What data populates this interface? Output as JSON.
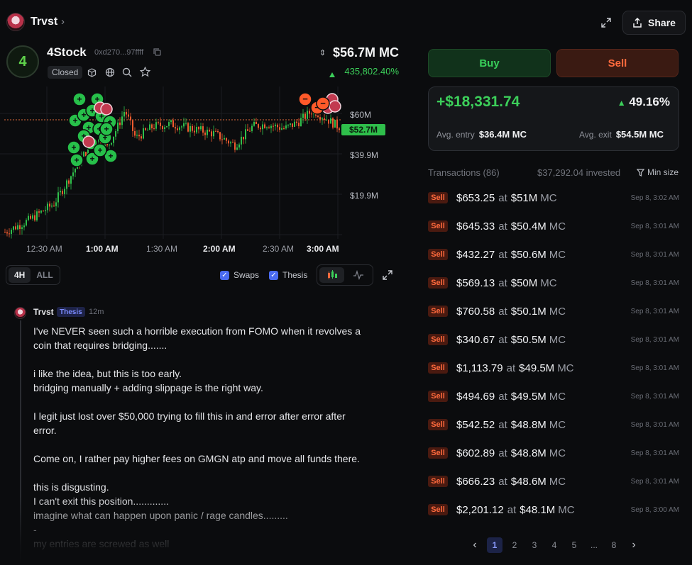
{
  "header": {
    "user_name": "Trvst",
    "share_label": "Share"
  },
  "token": {
    "name": "4Stock",
    "address": "0xd270...97ffff",
    "status": "Closed",
    "market_cap": "$56.7M MC",
    "change": "435,802.40%",
    "logo_text": "4"
  },
  "chart": {
    "time_labels": [
      "12:30 AM",
      "1:00 AM",
      "1:30 AM",
      "2:00 AM",
      "2:30 AM",
      "3:00 AM"
    ],
    "y_labels": [
      "$60M",
      "$39.9M",
      "$19.9M"
    ],
    "current_price": "$52.7M"
  },
  "chart_data": {
    "type": "line",
    "title": "",
    "xlabel": "",
    "ylabel": "",
    "x": [
      "12:30 AM",
      "1:00 AM",
      "1:30 AM",
      "2:00 AM",
      "2:30 AM",
      "3:00 AM"
    ],
    "y_ticks": [
      "$19.9M",
      "$39.9M",
      "$60M"
    ],
    "current_value": 52.7,
    "ylim": [
      5,
      70
    ]
  },
  "controls": {
    "range_4h": "4H",
    "range_all": "ALL",
    "swaps_label": "Swaps",
    "thesis_label": "Thesis"
  },
  "comment": {
    "author": "Trvst",
    "badge": "Thesis",
    "time": "12m",
    "paragraphs": [
      "I've NEVER seen such a horrible execution from FOMO when it revolves a coin that requires bridging.......",
      "i like the idea, but this is too early.\nbridging manually + adding slippage is the right way.",
      "I legit just lost over $50,000 trying to fill this in and error after error after error.",
      "Come on, I rather pay higher fees on GMGN atp and move all funds there.",
      "this is disgusting.\nI can't exit this position.............\nimagine what can happen upon panic / rage candles.........\n-\nmy entries are screwed as well"
    ]
  },
  "trade": {
    "buy_label": "Buy",
    "sell_label": "Sell",
    "pnl": "+$18,331.74",
    "pnl_pct": "49.16%",
    "avg_entry_label": "Avg. entry",
    "avg_entry": "$36.4M MC",
    "avg_exit_label": "Avg. exit",
    "avg_exit": "$54.5M MC"
  },
  "transactions": {
    "header": "Transactions (86)",
    "invested": "$37,292.04 invested",
    "min_size": "Min size",
    "sell_label": "Sell",
    "at_label": "at",
    "mc_label": "MC",
    "rows": [
      {
        "amount": "$653.25",
        "mc": "$51M",
        "time": "Sep 8, 3:02 AM"
      },
      {
        "amount": "$645.33",
        "mc": "$50.4M",
        "time": "Sep 8, 3:01 AM"
      },
      {
        "amount": "$432.27",
        "mc": "$50.6M",
        "time": "Sep 8, 3:01 AM"
      },
      {
        "amount": "$569.13",
        "mc": "$50M",
        "time": "Sep 8, 3:01 AM"
      },
      {
        "amount": "$760.58",
        "mc": "$50.1M",
        "time": "Sep 8, 3:01 AM"
      },
      {
        "amount": "$340.67",
        "mc": "$50.5M",
        "time": "Sep 8, 3:01 AM"
      },
      {
        "amount": "$1,113.79",
        "mc": "$49.5M",
        "time": "Sep 8, 3:01 AM"
      },
      {
        "amount": "$494.69",
        "mc": "$49.5M",
        "time": "Sep 8, 3:01 AM"
      },
      {
        "amount": "$542.52",
        "mc": "$48.8M",
        "time": "Sep 8, 3:01 AM"
      },
      {
        "amount": "$602.89",
        "mc": "$48.8M",
        "time": "Sep 8, 3:01 AM"
      },
      {
        "amount": "$666.23",
        "mc": "$48.6M",
        "time": "Sep 8, 3:01 AM"
      },
      {
        "amount": "$2,201.12",
        "mc": "$48.1M",
        "time": "Sep 8, 3:00 AM"
      }
    ]
  },
  "pagination": {
    "pages": [
      "1",
      "2",
      "3",
      "4",
      "5",
      "...",
      "8"
    ],
    "active": "1"
  }
}
